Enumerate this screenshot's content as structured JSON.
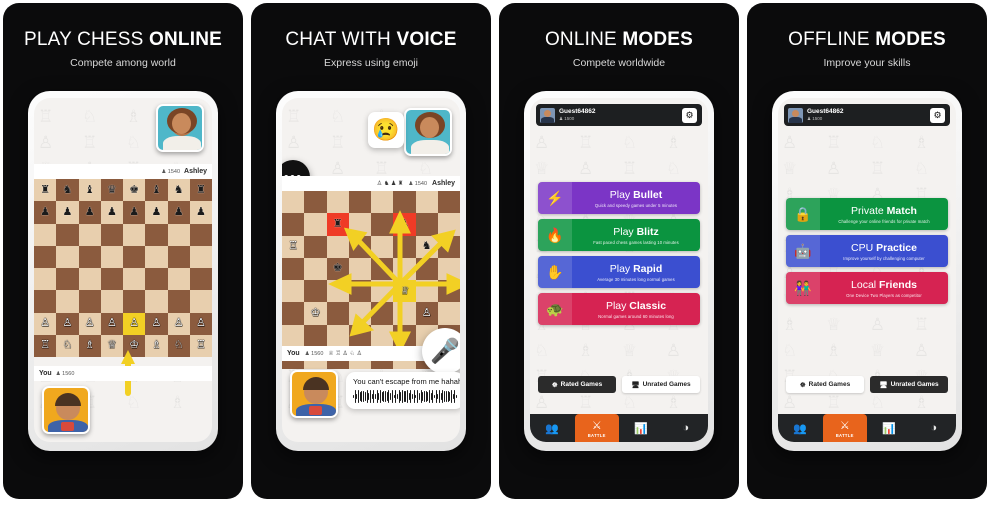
{
  "gallery": {
    "background": "#ffffff",
    "panel_bg": "#0b0b0c"
  },
  "panels": [
    {
      "id": "play-chess-online",
      "title_light": "PLAY CHESS ",
      "title_bold": "ONLINE",
      "subtitle": "Compete among world",
      "screen": {
        "opponent": {
          "name": "Ashley",
          "rating": "1540",
          "avatar": "female-avatar-teal"
        },
        "player": {
          "name": "You",
          "rating": "1560",
          "avatar": "male-avatar-yellow"
        },
        "move_highlight": "e2-e4",
        "board_light": "#e8cfae",
        "board_dark": "#8b5b3e",
        "highlight_color": "#f2d024"
      }
    },
    {
      "id": "chat-with-voice",
      "title_light": "CHAT WITH ",
      "title_bold": "VOICE",
      "subtitle": "Express using emoji",
      "screen": {
        "opponent": {
          "name": "Ashley",
          "rating": "1540",
          "avatar": "female-avatar-teal"
        },
        "player": {
          "name": "You",
          "rating": "1560",
          "avatar": "male-avatar-yellow"
        },
        "emoji_reaction": "😢",
        "chat_icon": "•••",
        "mic_icon": "🎤",
        "voice_message": "You can't escape from me hahaha",
        "captured_white": "♕ ♖ ♙ ♘ ♙",
        "captured_black": "♙ ♞ ♟ ♜",
        "attack_color": "#f2d024",
        "threat_color": "#ef3b26"
      }
    },
    {
      "id": "online-modes",
      "title_light": "ONLINE ",
      "title_bold": "MODES",
      "subtitle": "Compete worldwide",
      "screen": {
        "account": {
          "name": "Guest64862",
          "rating": "1500",
          "gear_icon": "⚙"
        },
        "modes": [
          {
            "icon": "⚡",
            "label_light": "Play ",
            "label_bold": "Bullet",
            "desc": "Quick and speedy games under 5 minutes",
            "color": "#7b35c6"
          },
          {
            "icon": "🔥",
            "label_light": "Play ",
            "label_bold": "Blitz",
            "desc": "Fast paced chess games lasting 10 minutes",
            "color": "#0b9440"
          },
          {
            "icon": "✋",
            "label_light": "Play ",
            "label_bold": "Rapid",
            "desc": "Average 30 minutes long normal games",
            "color": "#3b4fd0"
          },
          {
            "icon": "🐢",
            "label_light": "Play ",
            "label_bold": "Classic",
            "desc": "Normal games around 60 minutes long",
            "color": "#d62352"
          }
        ],
        "rated": {
          "rated_label": "Rated Games",
          "rated_icon": "☸",
          "unrated_label": "Unrated Games",
          "unrated_icon": "🖥",
          "active": "rated"
        },
        "nav": [
          {
            "icon": "👥",
            "label": "",
            "active": false
          },
          {
            "icon": "⚔",
            "label": "BATTLE",
            "active": true
          },
          {
            "icon": "📊",
            "label": "",
            "active": false
          },
          {
            "icon": "◑",
            "label": "",
            "active": false
          }
        ]
      }
    },
    {
      "id": "offline-modes",
      "title_light": "OFFLINE ",
      "title_bold": "MODES",
      "subtitle": "Improve your skills",
      "screen": {
        "account": {
          "name": "Guest64862",
          "rating": "1500",
          "gear_icon": "⚙"
        },
        "modes": [
          {
            "icon": "🔒",
            "label_light": "Private ",
            "label_bold": "Match",
            "desc": "Challenge your online friends for private match",
            "color": "#0b9440"
          },
          {
            "icon": "🤖",
            "label_light": "CPU ",
            "label_bold": "Practice",
            "desc": "Improve yourself by challenging computer",
            "color": "#3b4fd0"
          },
          {
            "icon": "👫",
            "label_light": "Local ",
            "label_bold": "Friends",
            "desc": "One Device Two Players as competitor",
            "color": "#d62352"
          }
        ],
        "rated": {
          "rated_label": "Rated Games",
          "rated_icon": "☸",
          "unrated_label": "Unrated Games",
          "unrated_icon": "🖥",
          "active": "unrated"
        },
        "nav": [
          {
            "icon": "👥",
            "label": "",
            "active": false
          },
          {
            "icon": "⚔",
            "label": "BATTLE",
            "active": true
          },
          {
            "icon": "📊",
            "label": "",
            "active": false
          },
          {
            "icon": "◑",
            "label": "",
            "active": false
          }
        ]
      }
    }
  ],
  "boards": {
    "panel1": [
      [
        "♜",
        "♞",
        "♝",
        "♛",
        "♚",
        "♝",
        "♞",
        "♜"
      ],
      [
        "♟",
        "♟",
        "♟",
        "♟",
        "♟",
        "♟",
        "♟",
        "♟"
      ],
      [
        "",
        "",
        "",
        "",
        "",
        "",
        "",
        ""
      ],
      [
        "",
        "",
        "",
        "",
        "",
        "",
        "",
        ""
      ],
      [
        "",
        "",
        "",
        "",
        "",
        "",
        "",
        ""
      ],
      [
        "",
        "",
        "",
        "",
        "",
        "",
        "",
        ""
      ],
      [
        "♙",
        "♙",
        "♙",
        "♙",
        "♙",
        "♙",
        "♙",
        "♙"
      ],
      [
        "♖",
        "♘",
        "♗",
        "♕",
        "♔",
        "♗",
        "♘",
        "♖"
      ]
    ],
    "panel2": [
      [
        "",
        "",
        "",
        "",
        "",
        "",
        "",
        ""
      ],
      [
        "",
        "",
        "♜",
        "",
        "",
        "♟",
        "",
        ""
      ],
      [
        "♖",
        "",
        "",
        "",
        "",
        "",
        "♞",
        ""
      ],
      [
        "",
        "",
        "♚",
        "",
        "",
        "",
        "",
        ""
      ],
      [
        "",
        "",
        "",
        "",
        "",
        "♕",
        "",
        ""
      ],
      [
        "",
        "♔",
        "",
        "",
        "",
        "",
        "♙",
        ""
      ],
      [
        "",
        "",
        "",
        "",
        "",
        "",
        "",
        ""
      ],
      [
        "",
        "",
        "",
        "",
        "",
        "",
        "",
        ""
      ]
    ]
  }
}
